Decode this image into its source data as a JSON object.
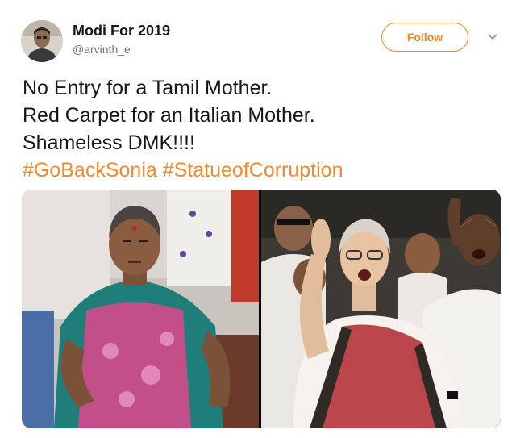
{
  "user": {
    "display_name": "Modi For 2019",
    "handle": "@arvinth_e",
    "avatar_icon": "user-avatar"
  },
  "actions": {
    "follow_label": "Follow",
    "more_icon": "chevron-down-icon",
    "accent_color": "#f4892b"
  },
  "tweet": {
    "lines": [
      "No Entry for a Tamil Mother.",
      "Red Carpet for an Italian Mother.",
      "Shameless DMK!!!!"
    ],
    "hashtags": [
      "#GoBackSonia",
      "#StatueofCorruption"
    ]
  },
  "media": {
    "count": 2
  }
}
